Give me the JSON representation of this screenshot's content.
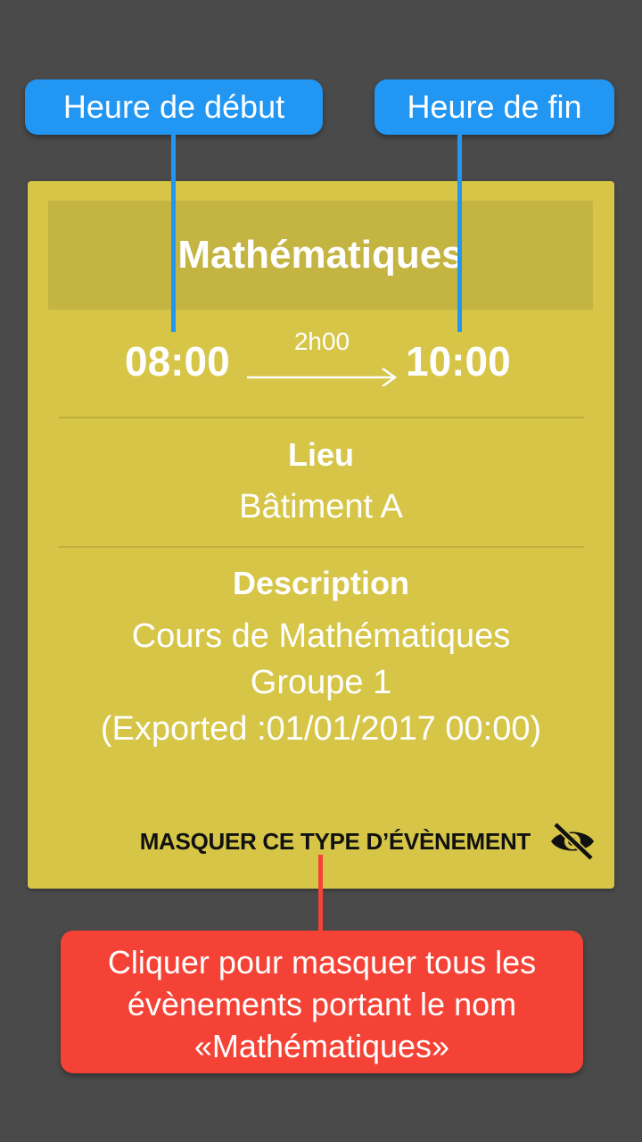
{
  "annotations": {
    "start_time": "Heure de début",
    "end_time": "Heure de fin",
    "hide_hint": [
      "Cliquer pour masquer tous les",
      "évènements portant le nom",
      "«Mathématiques»"
    ]
  },
  "event": {
    "title": "Mathématiques",
    "start": "08:00",
    "end": "10:00",
    "duration": "2h00",
    "location_label": "Lieu",
    "location": "Bâtiment A",
    "description_label": "Description",
    "description_lines": [
      "Cours de Mathématiques",
      "Groupe 1",
      "(Exported :01/01/2017 00:00)"
    ],
    "hide_button_label": "MASQUER CE TYPE D’ÉVÈNEMENT"
  },
  "colors": {
    "background": "#4a4a4a",
    "card": "#d6c547",
    "title_band": "#c4b442",
    "annotation_blue": "#2196f3",
    "annotation_red": "#f44336"
  },
  "icons": {
    "hide": "eye-off-icon",
    "arrow": "arrow-right-icon"
  }
}
